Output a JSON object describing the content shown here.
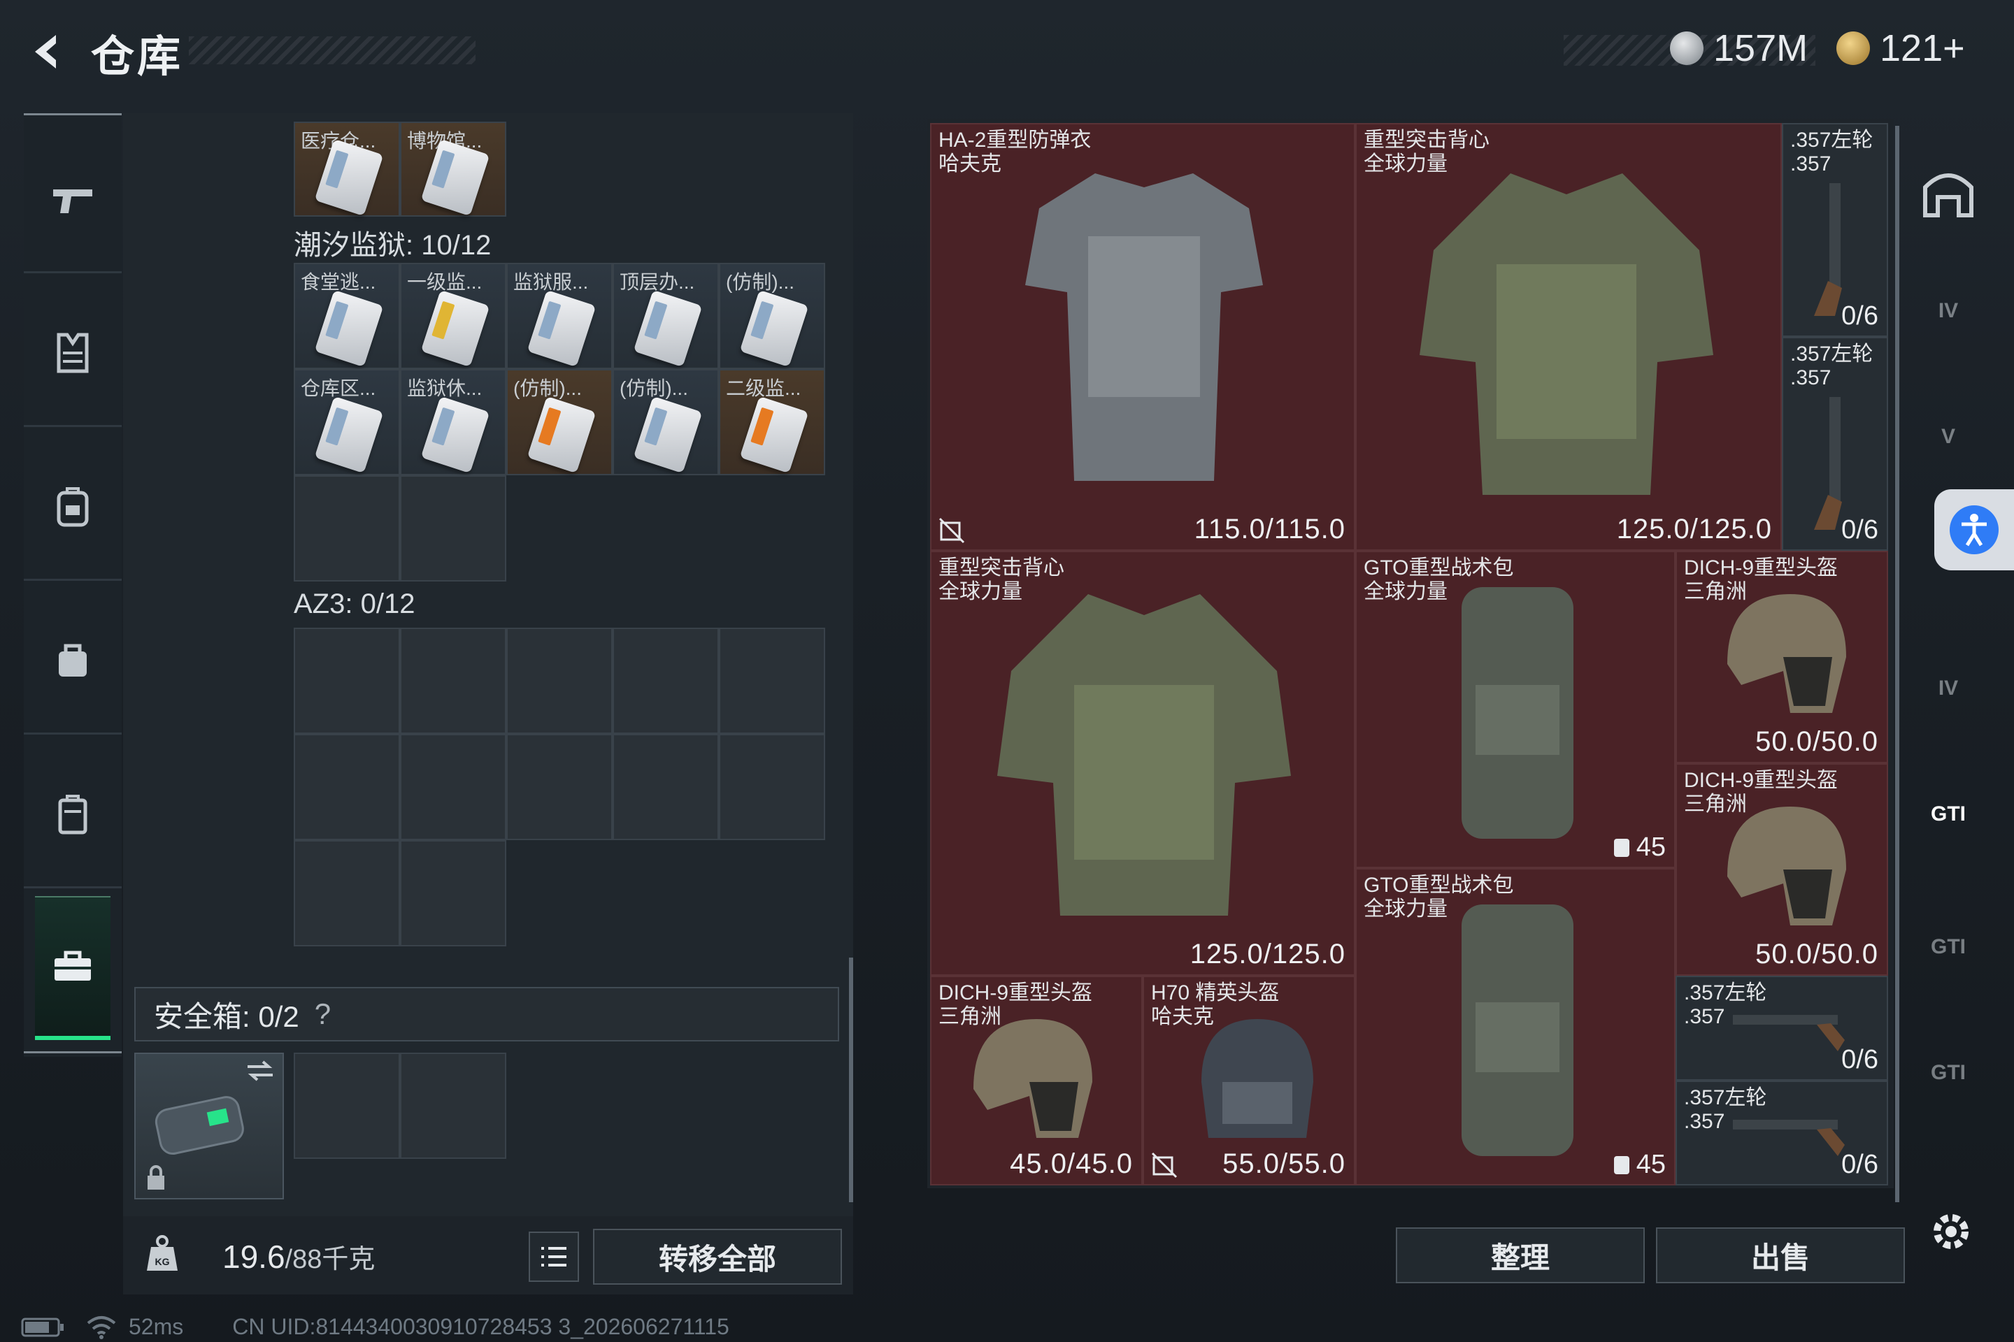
{
  "header": {
    "title": "仓库",
    "currency_1": "157M",
    "currency_2": "121+"
  },
  "left_nav": {
    "items": [
      "pistol-icon",
      "vest-icon",
      "backpack-icon",
      "bag-icon",
      "case-icon",
      "toolbox-icon"
    ],
    "active": "toolbox-icon"
  },
  "stash": {
    "top_items": [
      {
        "label": "医疗仓...",
        "color": "blue"
      },
      {
        "label": "博物馆...",
        "color": "blue"
      }
    ],
    "section_1": {
      "title": "潮汐监狱: 10/12",
      "items": [
        {
          "label": "食堂逃...",
          "color": "blue"
        },
        {
          "label": "一级监...",
          "color": "yellow"
        },
        {
          "label": "监狱服...",
          "color": "blue"
        },
        {
          "label": "顶层办...",
          "color": "blue"
        },
        {
          "label": "(仿制)...",
          "color": "blue"
        },
        {
          "label": "仓库区...",
          "color": "blue"
        },
        {
          "label": "监狱休...",
          "color": "blue"
        },
        {
          "label": "(仿制)...",
          "color": "orange"
        },
        {
          "label": "(仿制)...",
          "color": "blue"
        },
        {
          "label": "二级监...",
          "color": "orange"
        }
      ]
    },
    "section_2": {
      "title": "AZ3: 0/12"
    },
    "safebox": {
      "title": "安全箱: 0/2",
      "help": "?"
    },
    "weight": "19.6",
    "weight_max": "/88千克",
    "transfer_all": "转移全部"
  },
  "equipment": {
    "items": [
      {
        "name": "HA-2重型防弹衣\n哈夫克",
        "value": "115.0/115.0",
        "no_repair": true
      },
      {
        "name": "重型突击背心\n全球力量",
        "value": "125.0/125.0"
      },
      {
        "name": ".357左轮\n.357",
        "value": "0/6"
      },
      {
        "name": ".357左轮\n.357",
        "value": "0/6"
      },
      {
        "name": "重型突击背心\n全球力量",
        "value": "125.0/125.0"
      },
      {
        "name": "GTO重型战术包\n全球力量",
        "value": "45"
      },
      {
        "name": "DICH-9重型头盔\n三角洲",
        "value": "50.0/50.0"
      },
      {
        "name": "DICH-9重型头盔\n三角洲",
        "value": "50.0/50.0"
      },
      {
        "name": "GTO重型战术包\n全球力量",
        "value": "45"
      },
      {
        "name": "DICH-9重型头盔\n三角洲",
        "value": "45.0/45.0"
      },
      {
        "name": "H70 精英头盔\n哈夫克",
        "value": "55.0/55.0",
        "no_repair": true
      },
      {
        "name": ".357左轮\n.357",
        "value": "0/6"
      },
      {
        "name": ".357左轮\n.357",
        "value": "0/6"
      }
    ],
    "organize": "整理",
    "sell": "出售"
  },
  "right_nav": {
    "labels": [
      "IV",
      "V",
      "V",
      "IV",
      "GTI",
      "GTI",
      "GTI"
    ]
  },
  "status": {
    "ping": "52ms",
    "uid": "CN UID:8144340030910728453 3_202606271115"
  },
  "colors": {
    "accent": "#27e38a",
    "item_red": "#4a2226",
    "access": "#2f7cf6"
  }
}
